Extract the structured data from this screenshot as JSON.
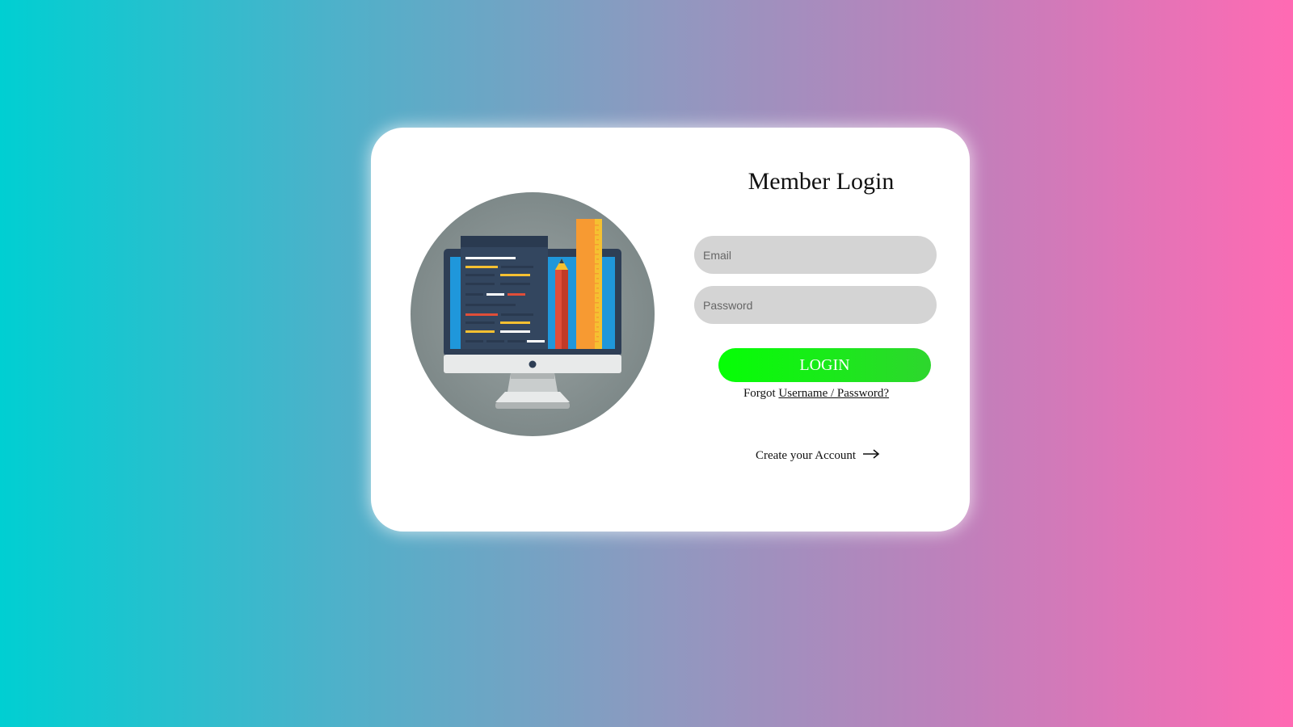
{
  "login": {
    "title": "Member Login",
    "email_placeholder": "Email",
    "password_placeholder": "Password",
    "login_label": "LOGIN",
    "forgot_prefix": "Forgot",
    "forgot_link": "Username / Password?",
    "create_account": "Create your Account"
  },
  "icons": {
    "illustration": "computer-monitor-with-pencil-and-ruler",
    "arrow": "arrow-right-icon"
  },
  "colors": {
    "gradient_left": "#00cfd2",
    "gradient_right": "#ff6ab3",
    "login_button": "#05ff05",
    "input_bg": "#d4d4d4"
  }
}
